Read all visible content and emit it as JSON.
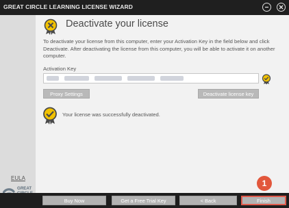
{
  "window": {
    "title": "GREAT CIRCLE LEARNING LICENSE WIZARD"
  },
  "sidebar": {
    "eula_label": "EULA",
    "logo_line1": "GREAT",
    "logo_line2": "CIRCLE",
    "logo_line3": "LEARNING"
  },
  "main": {
    "heading": "Deactivate your license",
    "description": "To deactivate your license from this computer, enter your Activation Key in the field below and click Deactivate. After deactivating the license from this computer, you will be able to activate it on another computer.",
    "activation_key_label": "Activation Key",
    "proxy_button": "Proxy Settings",
    "deactivate_button": "Deactivate license key",
    "success_message": "Your license was successfully deactivated."
  },
  "footer": {
    "buy_now": "Buy Now",
    "free_trial": "Get a Free Trial Key",
    "back": "< Back",
    "finish": "Finish"
  },
  "annotation": {
    "step": "1"
  },
  "colors": {
    "accent_yellow": "#f2c200",
    "annotation_red": "#e2573c",
    "button_gray": "#b9b9b9"
  },
  "icons": [
    "license-badge-icon",
    "checkmark-badge-icon",
    "minimize-icon",
    "close-icon"
  ]
}
